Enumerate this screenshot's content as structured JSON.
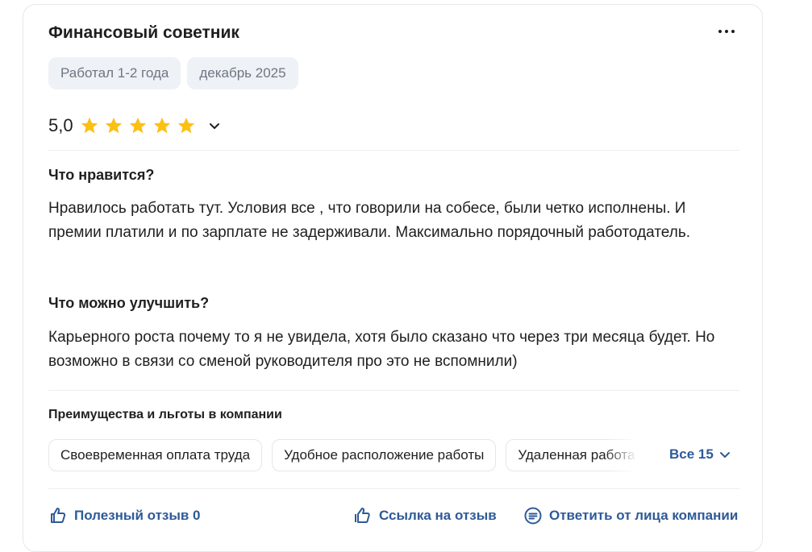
{
  "review": {
    "title": "Финансовый советник",
    "tags": [
      "Работал 1-2 года",
      "декабрь 2025"
    ],
    "rating_text": "5,0",
    "rating_stars": 5,
    "rating_max": 5,
    "star_color": "#fcc014",
    "likes_heading": "Что нравится?",
    "likes_text": "Нравилось работать тут. Условия все , что говорили на собесе, были четко исполнены. И премии платили и по зарплате не задерживали. Максимально порядочный работодатель.",
    "improve_heading": "Что можно улучшить?",
    "improve_text": "Карьерного роста почему то я не увидела, хотя было сказано что через три месяца будет. Но возможно в связи со сменой руководителя про это не вспомнили)"
  },
  "benefits": {
    "title": "Преимущества и льготы в компании",
    "chips": [
      "Своевременная оплата труда",
      "Удобное расположение работы",
      "Удаленная работа"
    ],
    "all_label": "Все 15"
  },
  "footer": {
    "helpful_label": "Полезный отзыв 0",
    "link_label": "Ссылка на отзыв",
    "reply_label": "Ответить от лица компании"
  },
  "icons": {
    "more": "more-dots-icon",
    "star": "star-icon",
    "chevron": "chevron-down-icon",
    "helpful": "thumbs-up-icon",
    "link": "link-icon",
    "reply": "reply-message-icon"
  },
  "colors": {
    "accent": "#2e5a98",
    "tag_bg": "#eef1f6",
    "tag_text": "#6e7682"
  }
}
